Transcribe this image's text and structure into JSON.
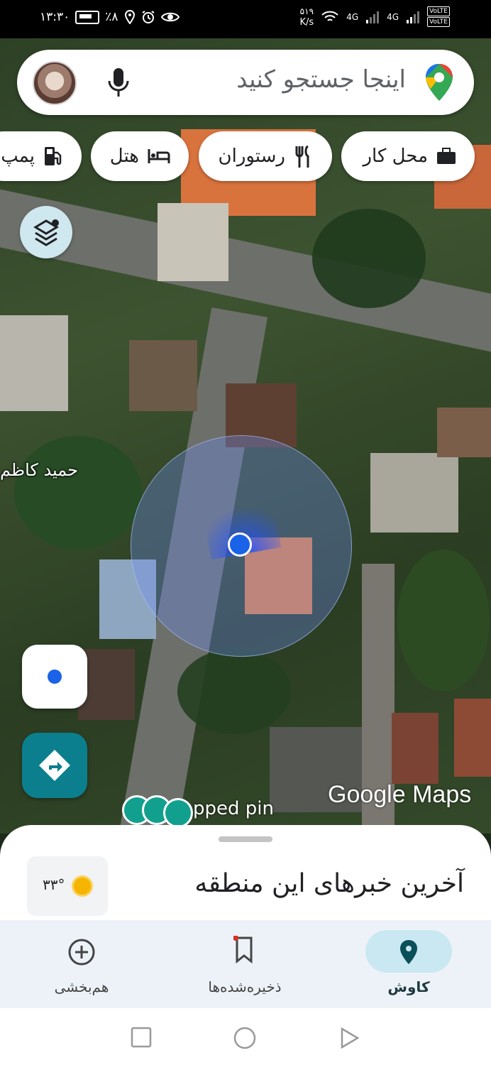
{
  "status_bar": {
    "time": "۱۳:۳۰",
    "battery": "٪۸",
    "speed_value": "۵۱۹",
    "speed_unit": "K/s",
    "net1": "4G",
    "net2": "4G",
    "volte1": "VoLTE",
    "volte2": "VoLTE"
  },
  "search": {
    "placeholder": "اینجا جستجو کنید"
  },
  "chips": [
    {
      "label": "محل کار",
      "icon": "briefcase-icon"
    },
    {
      "label": "رستوران",
      "icon": "restaurant-icon"
    },
    {
      "label": "هتل",
      "icon": "bed-icon"
    },
    {
      "label": "پمپ",
      "icon": "gas-station-icon"
    }
  ],
  "map": {
    "place_label": "حمید کاظم",
    "pinned_text": "pped pin",
    "logo": "Google Maps"
  },
  "sheet": {
    "news_title": "آخرین خبرهای این منطقه",
    "temperature": "۳۳°"
  },
  "bottom_nav": [
    {
      "label": "کاوش",
      "icon": "explore-pin-icon",
      "active": true
    },
    {
      "label": "ذخیره‌شده‌ها",
      "icon": "bookmark-icon",
      "active": false
    },
    {
      "label": "هم‌بخشی",
      "icon": "add-circle-icon",
      "active": false
    }
  ],
  "colors": {
    "accent_teal": "#0b7f8d",
    "location_blue": "#1a62e8",
    "active_pill": "#c9e8f2"
  }
}
